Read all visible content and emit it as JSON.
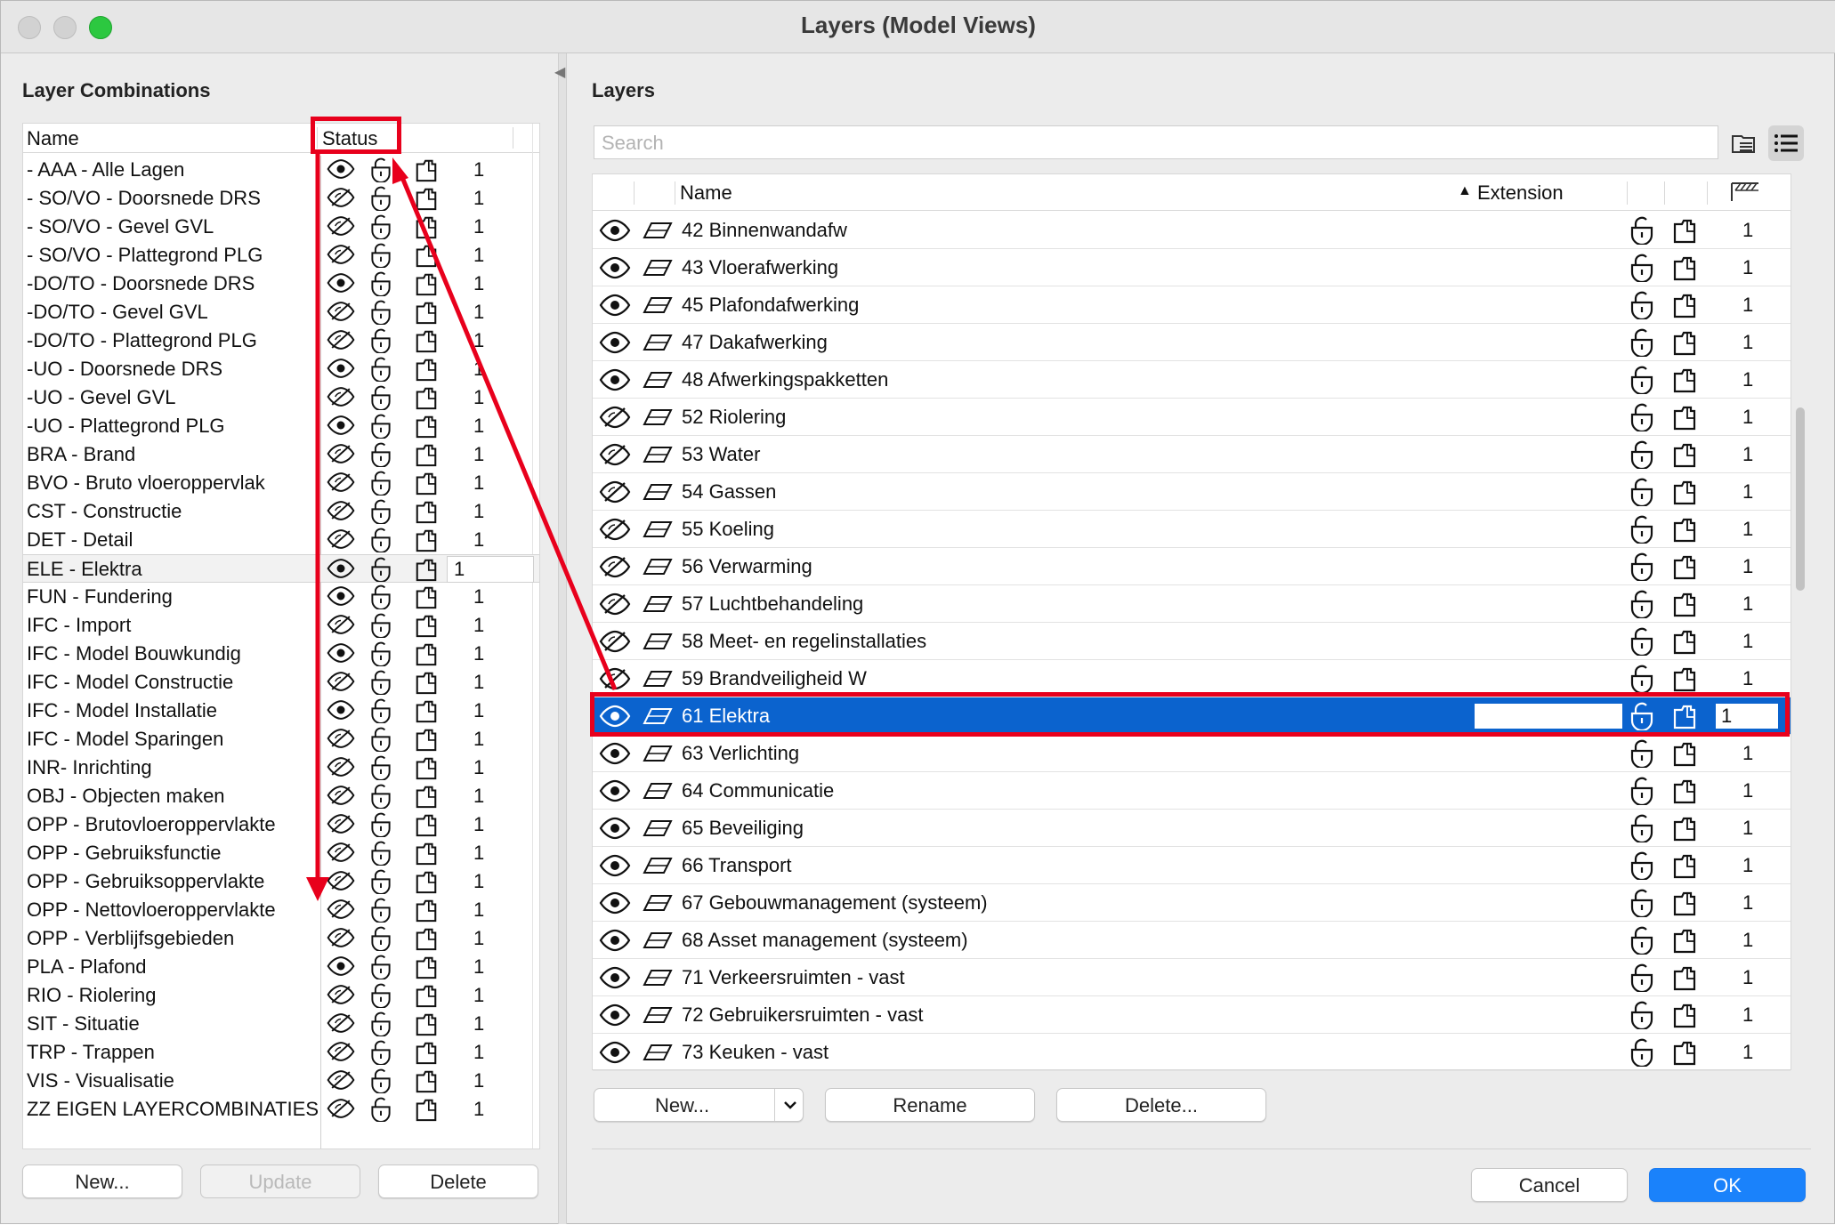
{
  "window": {
    "title": "Layers (Model Views)"
  },
  "left": {
    "heading": "Layer Combinations",
    "col_name": "Name",
    "col_status": "Status",
    "rows": [
      {
        "name": "- AAA - Alle Lagen",
        "visible": true,
        "num": "1"
      },
      {
        "name": "- SO/VO - Doorsnede DRS",
        "visible": false,
        "num": "1"
      },
      {
        "name": "- SO/VO - Gevel GVL",
        "visible": false,
        "num": "1"
      },
      {
        "name": "- SO/VO - Plattegrond PLG",
        "visible": false,
        "num": "1"
      },
      {
        "name": "-DO/TO - Doorsnede DRS",
        "visible": true,
        "num": "1"
      },
      {
        "name": "-DO/TO - Gevel GVL",
        "visible": false,
        "num": "1"
      },
      {
        "name": "-DO/TO - Plattegrond PLG",
        "visible": false,
        "num": "1"
      },
      {
        "name": "-UO - Doorsnede DRS",
        "visible": true,
        "num": "1"
      },
      {
        "name": "-UO - Gevel GVL",
        "visible": false,
        "num": "1"
      },
      {
        "name": "-UO - Plattegrond PLG",
        "visible": true,
        "num": "1"
      },
      {
        "name": "BRA - Brand",
        "visible": false,
        "num": "1"
      },
      {
        "name": "BVO - Bruto vloeroppervlak",
        "visible": false,
        "num": "1"
      },
      {
        "name": "CST - Constructie",
        "visible": false,
        "num": "1"
      },
      {
        "name": "DET - Detail",
        "visible": false,
        "num": "1"
      },
      {
        "name": "ELE - Elektra",
        "visible": true,
        "num": "1",
        "selected": true
      },
      {
        "name": "FUN - Fundering",
        "visible": true,
        "num": "1"
      },
      {
        "name": "IFC - Import",
        "visible": false,
        "num": "1"
      },
      {
        "name": "IFC - Model Bouwkundig",
        "visible": true,
        "num": "1"
      },
      {
        "name": "IFC - Model Constructie",
        "visible": false,
        "num": "1"
      },
      {
        "name": "IFC - Model Installatie",
        "visible": true,
        "num": "1"
      },
      {
        "name": "IFC - Model Sparingen",
        "visible": false,
        "num": "1"
      },
      {
        "name": "INR- Inrichting",
        "visible": false,
        "num": "1"
      },
      {
        "name": "OBJ - Objecten maken",
        "visible": false,
        "num": "1"
      },
      {
        "name": "OPP - Brutovloeroppervlakte",
        "visible": false,
        "num": "1"
      },
      {
        "name": "OPP - Gebruiksfunctie",
        "visible": false,
        "num": "1"
      },
      {
        "name": "OPP - Gebruiksoppervlakte",
        "visible": false,
        "num": "1"
      },
      {
        "name": "OPP - Nettovloeroppervlakte",
        "visible": false,
        "num": "1"
      },
      {
        "name": "OPP - Verblijfsgebieden",
        "visible": false,
        "num": "1"
      },
      {
        "name": "PLA - Plafond",
        "visible": true,
        "num": "1"
      },
      {
        "name": "RIO - Riolering",
        "visible": false,
        "num": "1"
      },
      {
        "name": "SIT - Situatie",
        "visible": false,
        "num": "1"
      },
      {
        "name": "TRP - Trappen",
        "visible": false,
        "num": "1"
      },
      {
        "name": "VIS - Visualisatie",
        "visible": false,
        "num": "1"
      },
      {
        "name": "ZZ EIGEN LAYERCOMBINATIES",
        "visible": false,
        "num": "1"
      }
    ],
    "buttons": {
      "new": "New...",
      "update": "Update",
      "delete": "Delete"
    }
  },
  "right": {
    "heading": "Layers",
    "search_placeholder": "Search",
    "col_name": "Name",
    "col_extension": "Extension",
    "rows": [
      {
        "name": "42 Binnenwandafw",
        "visible": true,
        "num": "1"
      },
      {
        "name": "43 Vloerafwerking",
        "visible": true,
        "num": "1"
      },
      {
        "name": "45 Plafondafwerking",
        "visible": true,
        "num": "1"
      },
      {
        "name": "47 Dakafwerking",
        "visible": true,
        "num": "1"
      },
      {
        "name": "48 Afwerkingspakketten",
        "visible": true,
        "num": "1"
      },
      {
        "name": "52 Riolering",
        "visible": false,
        "num": "1"
      },
      {
        "name": "53 Water",
        "visible": false,
        "num": "1"
      },
      {
        "name": "54 Gassen",
        "visible": false,
        "num": "1"
      },
      {
        "name": "55 Koeling",
        "visible": false,
        "num": "1"
      },
      {
        "name": "56 Verwarming",
        "visible": false,
        "num": "1"
      },
      {
        "name": "57 Luchtbehandeling",
        "visible": false,
        "num": "1"
      },
      {
        "name": "58 Meet- en regelinstallaties",
        "visible": false,
        "num": "1"
      },
      {
        "name": "59 Brandveiligheid W",
        "visible": false,
        "num": "1"
      },
      {
        "name": "61 Elektra",
        "visible": true,
        "num": "1",
        "selected": true
      },
      {
        "name": "63 Verlichting",
        "visible": true,
        "num": "1"
      },
      {
        "name": "64 Communicatie",
        "visible": true,
        "num": "1"
      },
      {
        "name": "65 Beveiliging",
        "visible": true,
        "num": "1"
      },
      {
        "name": "66 Transport",
        "visible": true,
        "num": "1"
      },
      {
        "name": "67 Gebouwmanagement (systeem)",
        "visible": true,
        "num": "1"
      },
      {
        "name": "68 Asset management (systeem)",
        "visible": true,
        "num": "1"
      },
      {
        "name": "71 Verkeersruimten - vast",
        "visible": true,
        "num": "1"
      },
      {
        "name": "72 Gebruikersruimten - vast",
        "visible": true,
        "num": "1"
      },
      {
        "name": "73 Keuken - vast",
        "visible": true,
        "num": "1"
      }
    ],
    "buttons": {
      "new": "New...",
      "rename": "Rename",
      "delete": "Delete..."
    }
  },
  "footer": {
    "cancel": "Cancel",
    "ok": "OK"
  },
  "colors": {
    "selection": "#0b63ce",
    "annotation": "#e8001c",
    "ok": "#1a82fb"
  }
}
